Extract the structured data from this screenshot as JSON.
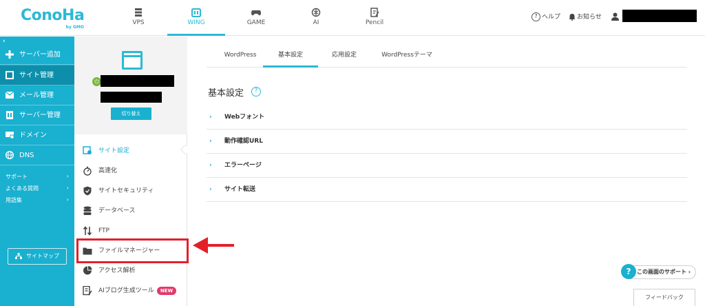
{
  "header": {
    "logo_text": "ConoHa",
    "logo_sub": "by GMO",
    "nav": [
      {
        "label": "VPS",
        "icon": "server-icon"
      },
      {
        "label": "WING",
        "icon": "wing-icon",
        "active": true
      },
      {
        "label": "GAME",
        "icon": "gamepad-icon"
      },
      {
        "label": "AI",
        "icon": "brain-icon"
      },
      {
        "label": "Pencil",
        "icon": "pencil-doc-icon"
      }
    ],
    "help_label": "ヘルプ",
    "notice_label": "お知らせ"
  },
  "sidebar": {
    "collapse_glyph": "‹",
    "items": [
      {
        "label": "サーバー追加",
        "icon": "plus-icon"
      },
      {
        "label": "サイト管理",
        "icon": "site-icon",
        "active": true
      },
      {
        "label": "メール管理",
        "icon": "mail-icon"
      },
      {
        "label": "サーバー管理",
        "icon": "server-manage-icon"
      },
      {
        "label": "ドメイン",
        "icon": "domain-icon"
      },
      {
        "label": "DNS",
        "icon": "globe-icon"
      }
    ],
    "links": [
      {
        "label": "サポート"
      },
      {
        "label": "よくある質問"
      },
      {
        "label": "用語集"
      }
    ],
    "sitemap_label": "サイトマップ"
  },
  "subpanel": {
    "switch_label": "切り替え",
    "items": [
      {
        "label": "サイト設定",
        "icon": "site-settings-icon",
        "active": true
      },
      {
        "label": "高速化",
        "icon": "stopwatch-icon"
      },
      {
        "label": "サイトセキュリティ",
        "icon": "shield-icon"
      },
      {
        "label": "データベース",
        "icon": "database-icon"
      },
      {
        "label": "FTP",
        "icon": "transfer-icon"
      },
      {
        "label": "ファイルマネージャー",
        "icon": "folder-icon"
      },
      {
        "label": "アクセス解析",
        "icon": "pie-chart-icon"
      },
      {
        "label": "AIブログ生成ツール",
        "icon": "ai-doc-icon",
        "badge": "NEW"
      }
    ]
  },
  "main": {
    "tabs": [
      {
        "label": "WordPress"
      },
      {
        "label": "基本設定",
        "active": true
      },
      {
        "label": "応用設定"
      },
      {
        "label": "WordPressテーマ"
      }
    ],
    "section_title": "基本設定",
    "help_glyph": "?",
    "accordion": [
      {
        "label": "Webフォント"
      },
      {
        "label": "動作確認URL"
      },
      {
        "label": "エラーページ"
      },
      {
        "label": "サイト転送"
      }
    ],
    "support_label": "この画面のサポート",
    "feedback_label": "フィードバック"
  },
  "colors": {
    "brand": "#1ab0cf",
    "brand_dark": "#0d8fab",
    "highlight": "#e3202a",
    "badge": "#e23a6a"
  }
}
